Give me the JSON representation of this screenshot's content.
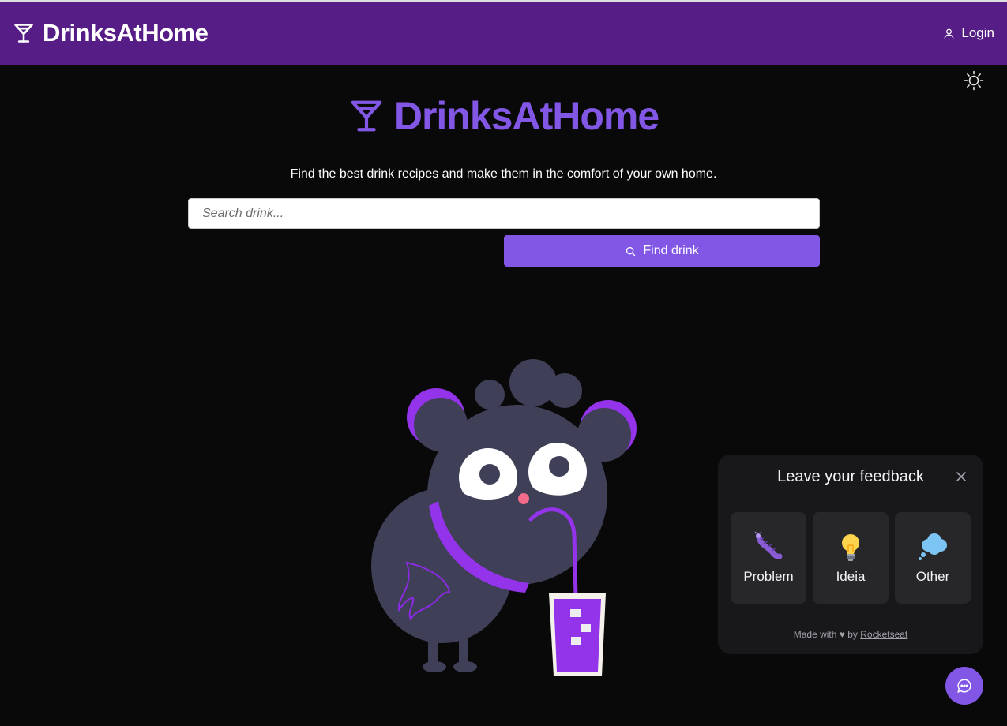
{
  "header": {
    "brand": "DrinksAtHome",
    "login_label": "Login"
  },
  "hero": {
    "title": "DrinksAtHome",
    "tagline": "Find the best drink recipes and make them in the comfort of your own home.",
    "search_placeholder": "Search drink...",
    "find_button": "Find drink"
  },
  "feedback": {
    "title": "Leave your feedback",
    "options": [
      {
        "label": "Problem",
        "icon": "bug-icon"
      },
      {
        "label": "Ideia",
        "icon": "lightbulb-icon"
      },
      {
        "label": "Other",
        "icon": "thought-cloud-icon"
      }
    ],
    "footer_prefix": "Made with ♥ by",
    "footer_link": "Rocketseat"
  },
  "colors": {
    "header_bg": "#561d87",
    "accent": "#8257e5",
    "page_bg": "#09090a",
    "widget_bg": "#18181b",
    "option_bg": "#27272a"
  }
}
